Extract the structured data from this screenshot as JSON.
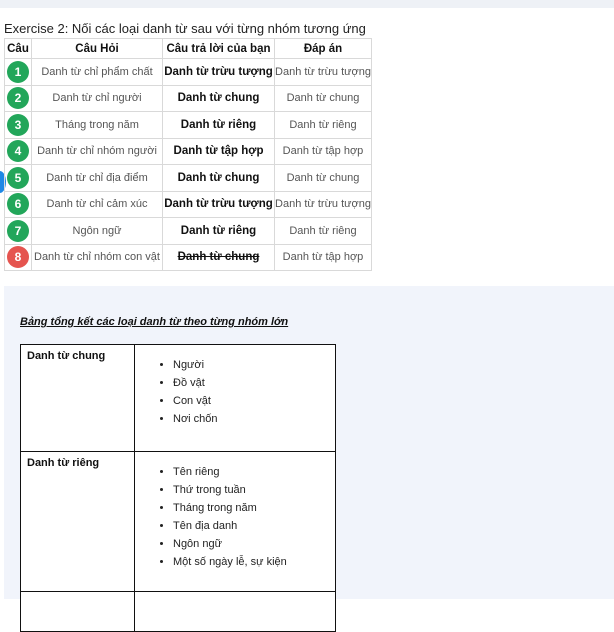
{
  "exercise": {
    "title": "Exercise 2: Nối các loại danh từ sau với từng nhóm tương ứng",
    "headers": [
      "Câu",
      "Câu Hỏi",
      "Câu trả lời của bạn",
      "Đáp án"
    ],
    "rows": [
      {
        "num": "1",
        "question": "Danh từ chỉ phẩm chất",
        "answer": "Danh từ trừu tượng",
        "key": "Danh từ trừu tượng",
        "correct": true
      },
      {
        "num": "2",
        "question": "Danh từ chỉ người",
        "answer": "Danh từ chung",
        "key": "Danh từ chung",
        "correct": true
      },
      {
        "num": "3",
        "question": "Tháng trong năm",
        "answer": "Danh từ riêng",
        "key": "Danh từ riêng",
        "correct": true
      },
      {
        "num": "4",
        "question": "Danh từ chỉ nhóm người",
        "answer": "Danh từ tập hợp",
        "key": "Danh từ tập hợp",
        "correct": true
      },
      {
        "num": "5",
        "question": "Danh từ chỉ địa điểm",
        "answer": "Danh từ chung",
        "key": "Danh từ chung",
        "correct": true
      },
      {
        "num": "6",
        "question": "Danh từ chỉ cảm xúc",
        "answer": "Danh từ trừu tượng",
        "key": "Danh từ trừu tượng",
        "correct": true
      },
      {
        "num": "7",
        "question": "Ngôn ngữ",
        "answer": "Danh từ riêng",
        "key": "Danh từ riêng",
        "correct": true
      },
      {
        "num": "8",
        "question": "Danh từ chỉ nhóm con vật",
        "answer": "Danh từ chung",
        "key": "Danh từ tập hợp",
        "correct": false
      }
    ]
  },
  "colors": {
    "correct": "#22a65a",
    "wrong": "#e5544f",
    "accent": "#1e88e5"
  },
  "summary": {
    "title": "Bảng tổng kết các loại danh từ theo từng nhóm lớn",
    "groups": [
      {
        "category": "Danh từ chung",
        "items": [
          "Người",
          "Đồ vật",
          "Con vật",
          "Nơi chốn"
        ]
      },
      {
        "category": "Danh từ riêng",
        "items": [
          "Tên riêng",
          "Thứ trong tuần",
          "Tháng trong năm",
          "Tên địa danh",
          "Ngôn ngữ",
          "Một số ngày lễ, sự kiện"
        ]
      },
      {
        "category": "",
        "items": []
      }
    ]
  }
}
